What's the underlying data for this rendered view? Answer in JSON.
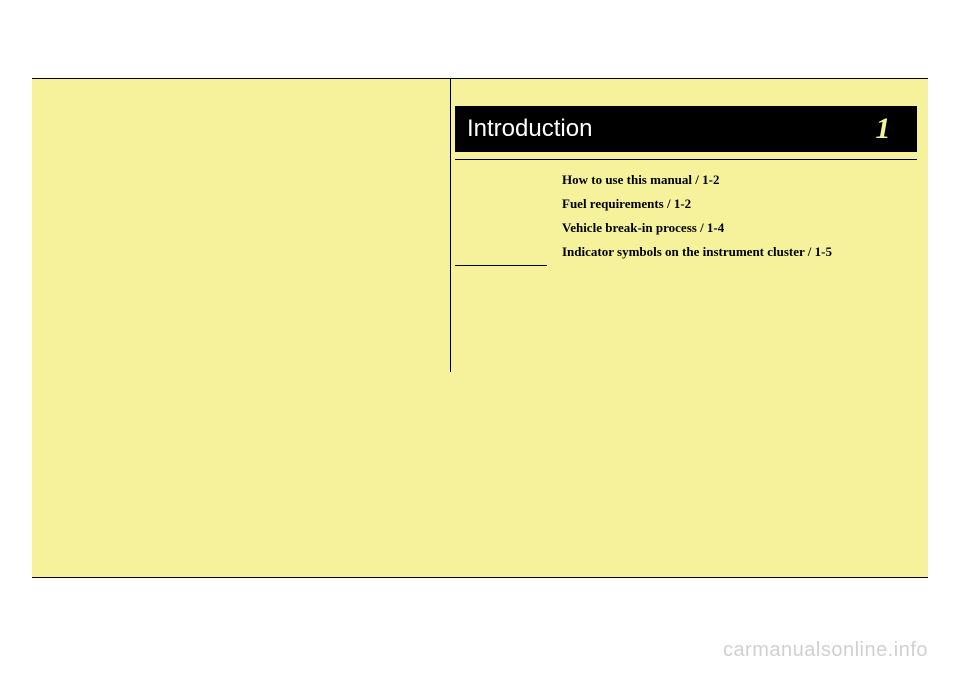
{
  "chapter": {
    "title": "Introduction",
    "number": "1"
  },
  "toc": {
    "items": [
      "How to use this manual / 1-2",
      "Fuel requirements / 1-2",
      "Vehicle break-in process / 1-4",
      "Indicator symbols on the instrument cluster / 1-5"
    ]
  },
  "watermark": "carmanualsonline.info"
}
